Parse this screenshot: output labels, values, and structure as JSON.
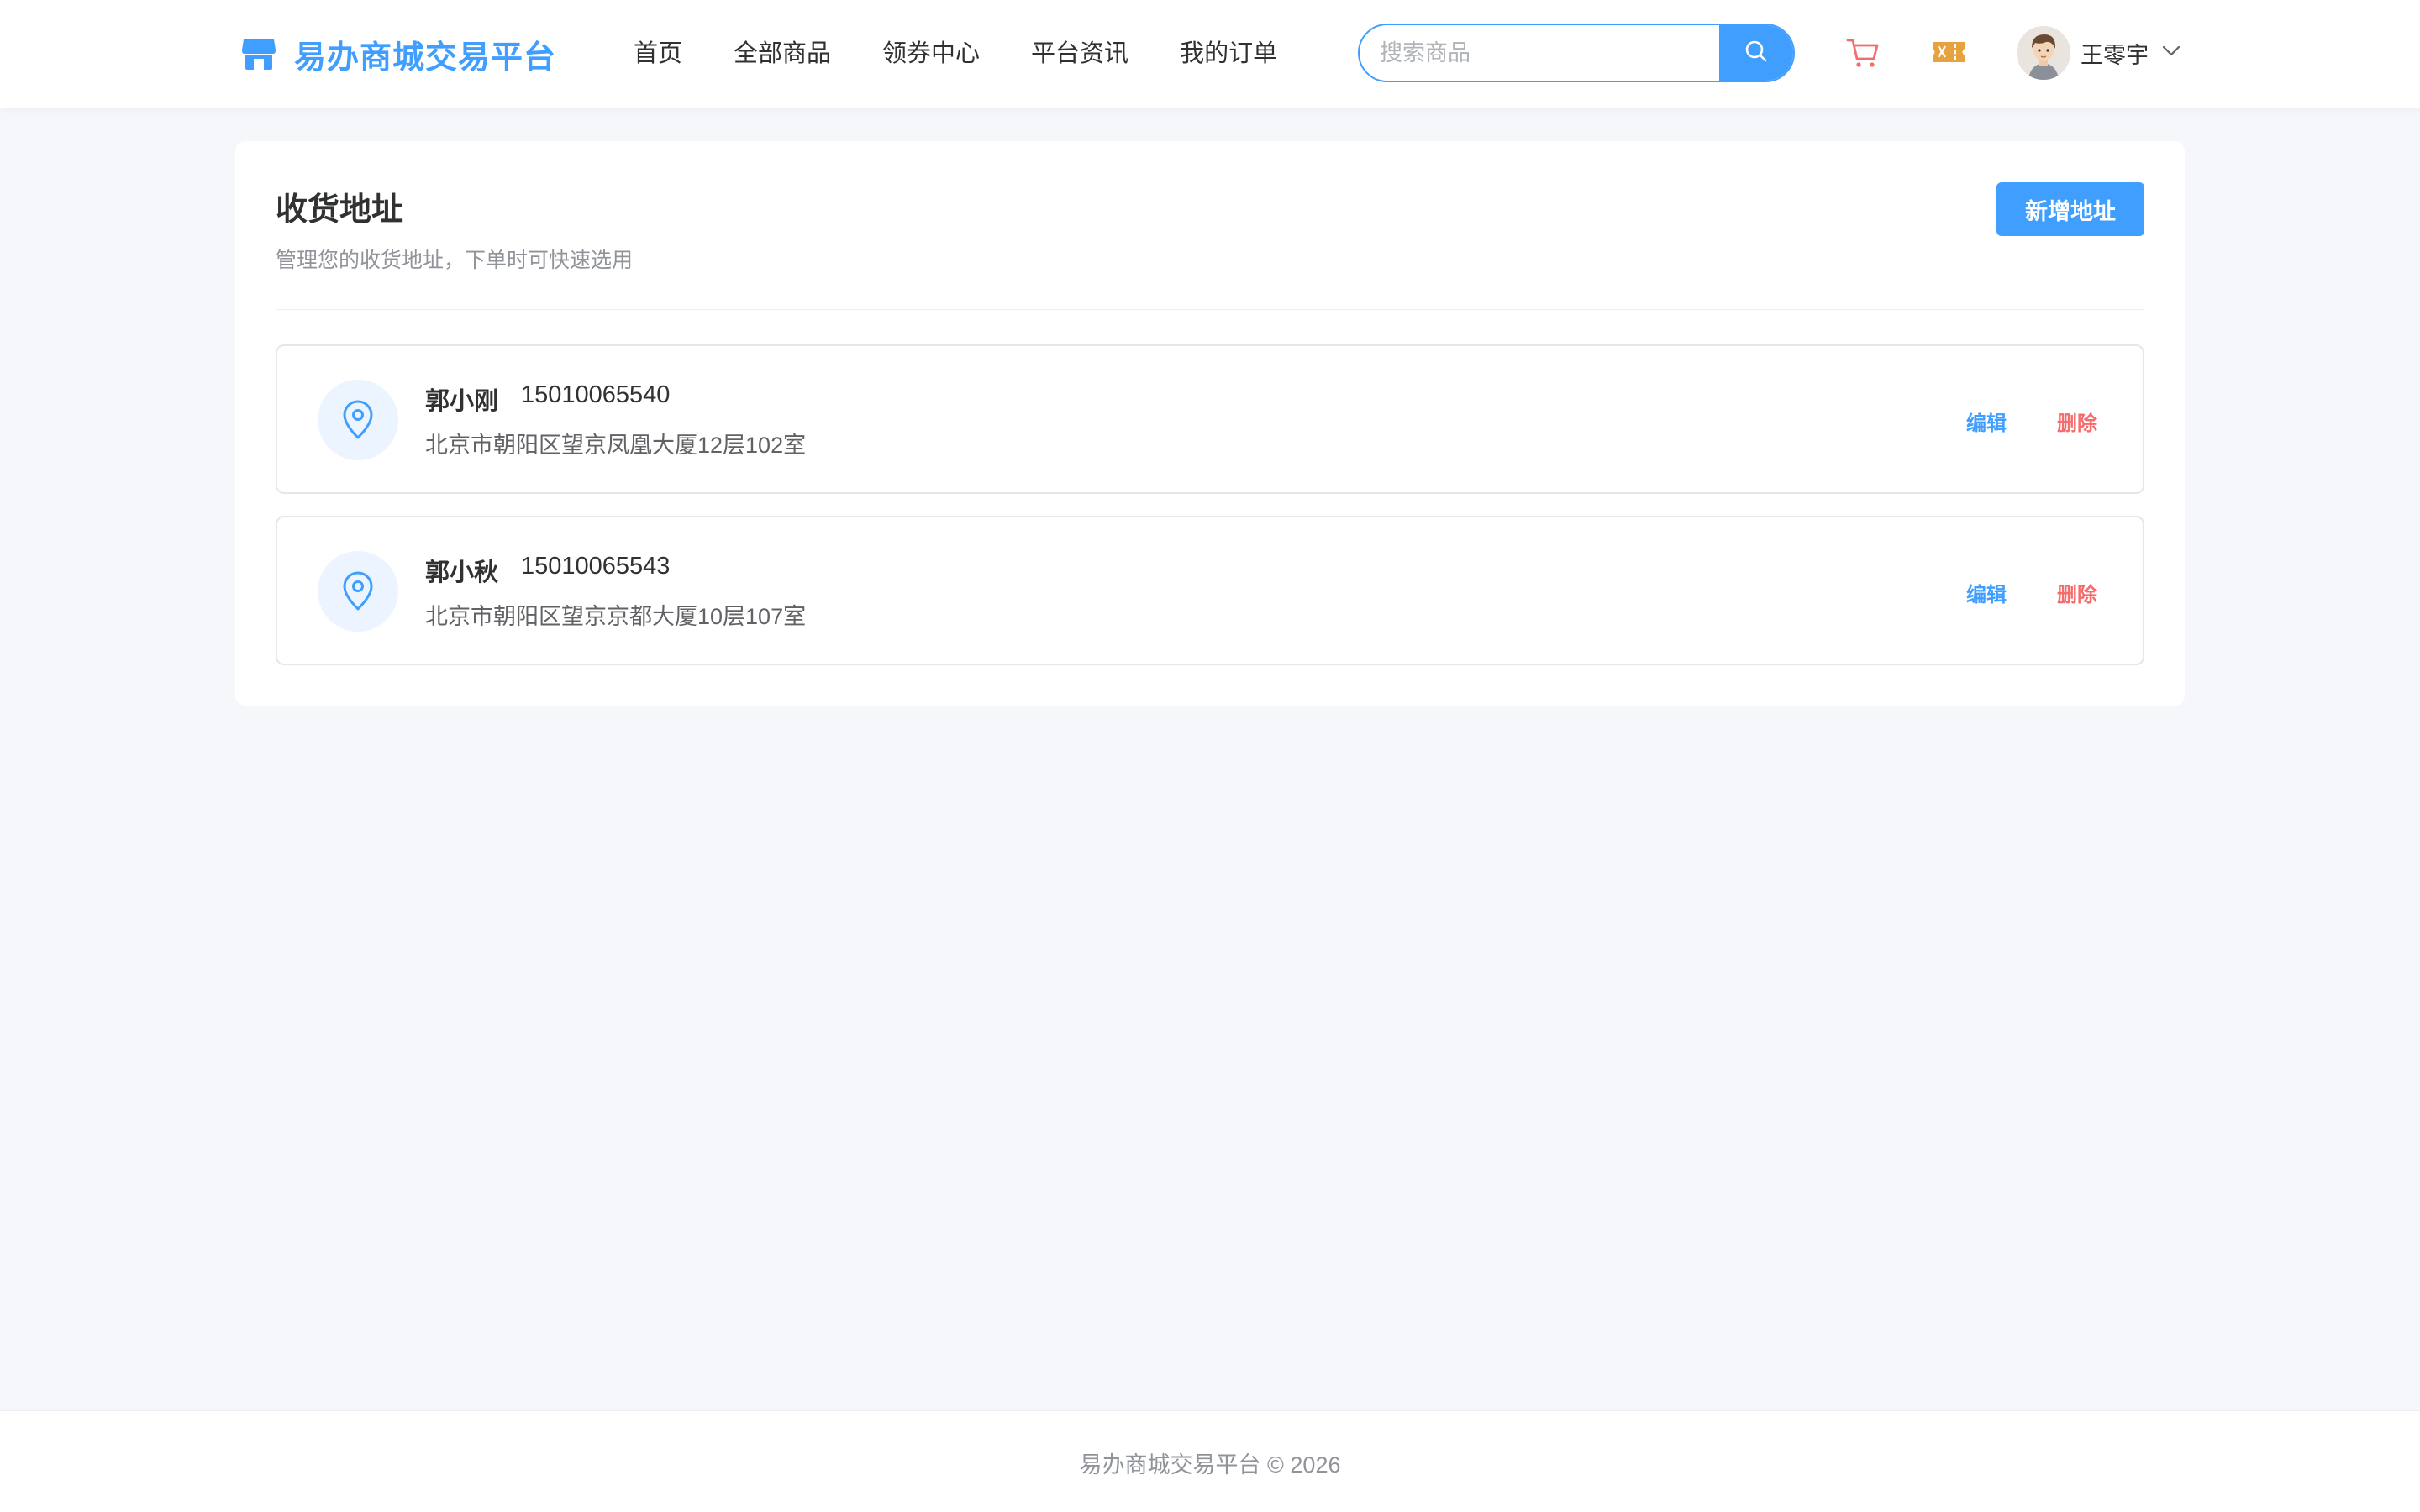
{
  "header": {
    "brand": "易办商城交易平台",
    "nav": [
      {
        "label": "首页"
      },
      {
        "label": "全部商品"
      },
      {
        "label": "领券中心"
      },
      {
        "label": "平台资讯"
      },
      {
        "label": "我的订单"
      }
    ],
    "search": {
      "placeholder": "搜索商品",
      "value": ""
    },
    "icons": {
      "logo": "storefront-icon",
      "search": "search-icon",
      "cart": "cart-icon",
      "coupon": "coupon-ticket-icon",
      "dropdown": "chevron-down-icon"
    },
    "user": {
      "name": "王零宇"
    }
  },
  "page": {
    "title": "收货地址",
    "subtitle": "管理您的收货地址，下单时可快速选用",
    "add_button": "新增地址"
  },
  "addresses": [
    {
      "name": "郭小刚",
      "phone": "15010065540",
      "detail": "北京市朝阳区望京凤凰大厦12层102室",
      "edit_label": "编辑",
      "delete_label": "删除"
    },
    {
      "name": "郭小秋",
      "phone": "15010065543",
      "detail": "北京市朝阳区望京京都大厦10层107室",
      "edit_label": "编辑",
      "delete_label": "删除"
    }
  ],
  "footer": {
    "text": "易办商城交易平台 © 2026"
  },
  "colors": {
    "primary": "#409eff",
    "danger": "#f56c6c",
    "coupon": "#e6a23c",
    "cart": "#f56c6c",
    "background": "#f5f7fa"
  }
}
